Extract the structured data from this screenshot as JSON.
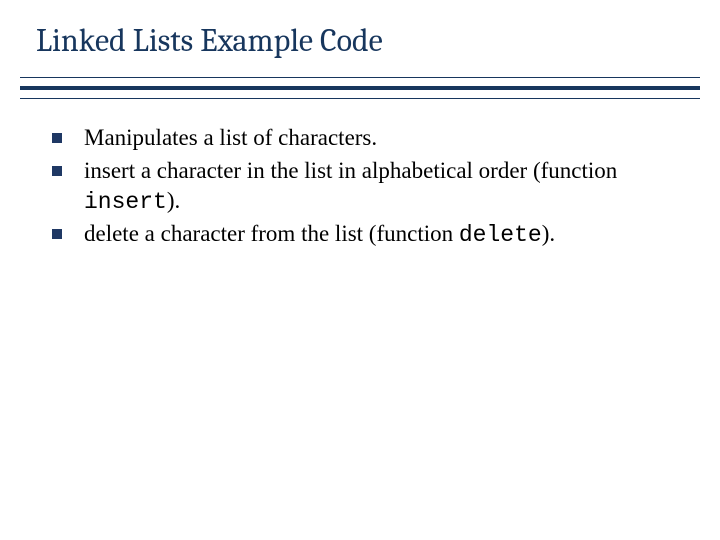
{
  "title": "Linked Lists Example Code",
  "bullets": [
    {
      "pre": "Manipulates a list of characters.",
      "code": "",
      "post": ""
    },
    {
      "pre": "insert a character in the list in alphabetical order (function ",
      "code": "insert",
      "post": ")."
    },
    {
      "pre": "delete a character from the list (function ",
      "code": "delete",
      "post": ")."
    }
  ]
}
